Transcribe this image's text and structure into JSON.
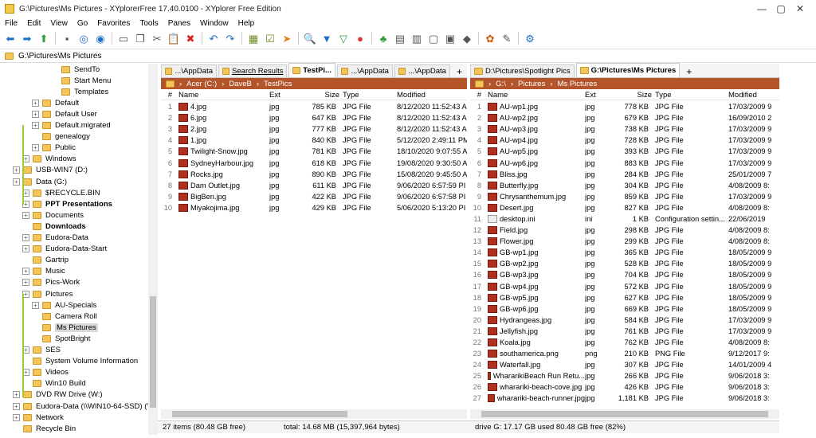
{
  "title": "G:\\Pictures\\Ms Pictures - XYplorerFree 17.40.0100 - XYplorer Free Edition",
  "window_controls": {
    "minimize": "—",
    "maximize": "▢",
    "close": "✕"
  },
  "menu": [
    "File",
    "Edit",
    "View",
    "Go",
    "Favorites",
    "Tools",
    "Panes",
    "Window",
    "Help"
  ],
  "toolbar_icons": [
    "back-icon",
    "forward-icon",
    "up-icon",
    "drives-icon",
    "target-icon",
    "target2-icon",
    "new-icon",
    "copy-icon",
    "cut-icon",
    "paste-icon",
    "delete-icon",
    "undo-icon",
    "redo-icon",
    "tree-icon",
    "checkbox-icon",
    "arrow-icon",
    "search-icon",
    "filter-icon",
    "filter2-icon",
    "palette-icon",
    "tree2-icon",
    "grid-icon",
    "panes-icon",
    "preview-icon",
    "preview2-icon",
    "tag-icon",
    "colors-icon",
    "brush-icon",
    "settings-icon"
  ],
  "address": "G:\\Pictures\\Ms Pictures",
  "tree": [
    {
      "label": "SendTo",
      "indent": 5,
      "exp": false
    },
    {
      "label": "Start Menu",
      "indent": 5,
      "exp": false
    },
    {
      "label": "Templates",
      "indent": 5,
      "exp": false
    },
    {
      "label": "Default",
      "indent": 3,
      "exp": true
    },
    {
      "label": "Default User",
      "indent": 3,
      "exp": true
    },
    {
      "label": "Default.migrated",
      "indent": 3,
      "exp": true
    },
    {
      "label": "genealogy",
      "indent": 3,
      "exp": false
    },
    {
      "label": "Public",
      "indent": 3,
      "exp": true
    },
    {
      "label": "Windows",
      "indent": 2,
      "exp": true
    },
    {
      "label": "USB-WIN7 (D:)",
      "indent": 1,
      "exp": true
    },
    {
      "label": "Data (G:)",
      "indent": 1,
      "exp": true
    },
    {
      "label": "$RECYCLE.BIN",
      "indent": 2,
      "exp": true
    },
    {
      "label": "PPT Presentations",
      "indent": 2,
      "exp": true,
      "bold": true
    },
    {
      "label": "Documents",
      "indent": 2,
      "exp": true
    },
    {
      "label": "Downloads",
      "indent": 2,
      "exp": false,
      "bold": true
    },
    {
      "label": "Eudora-Data",
      "indent": 2,
      "exp": true
    },
    {
      "label": "Eudora-Data-Start",
      "indent": 2,
      "exp": true
    },
    {
      "label": "Gartrip",
      "indent": 2,
      "exp": false
    },
    {
      "label": "Music",
      "indent": 2,
      "exp": true
    },
    {
      "label": "Pics-Work",
      "indent": 2,
      "exp": true
    },
    {
      "label": "Pictures",
      "indent": 2,
      "exp": true
    },
    {
      "label": "AU-Specials",
      "indent": 3,
      "exp": true
    },
    {
      "label": "Camera Roll",
      "indent": 3,
      "exp": false
    },
    {
      "label": "Ms Pictures",
      "indent": 3,
      "exp": false,
      "selected": true
    },
    {
      "label": "SpotBright",
      "indent": 3,
      "exp": false
    },
    {
      "label": "SES",
      "indent": 2,
      "exp": true
    },
    {
      "label": "System Volume Information",
      "indent": 2,
      "exp": false
    },
    {
      "label": "Videos",
      "indent": 2,
      "exp": true
    },
    {
      "label": "Win10 Build",
      "indent": 2,
      "exp": false
    },
    {
      "label": "DVD RW Drive (W:)",
      "indent": 1,
      "exp": true
    },
    {
      "label": "Eudora-Data (\\\\WIN10-64-SSD) (Y:)",
      "indent": 1,
      "exp": true
    },
    {
      "label": "Network",
      "indent": 1,
      "exp": true
    },
    {
      "label": "Recycle Bin",
      "indent": 1,
      "exp": false
    }
  ],
  "left_pane": {
    "tabs": [
      {
        "label": "...\\AppData"
      },
      {
        "label": "Search Results",
        "underline": true
      },
      {
        "label": "TestPi...",
        "active": true
      },
      {
        "label": "...\\AppData"
      },
      {
        "label": "...\\AppData"
      }
    ],
    "add_tab": "+",
    "crumbs": [
      "Acer (C:)",
      "DaveB",
      "TestPics"
    ],
    "columns": {
      "num": "#",
      "name": "Name",
      "ext": "Ext",
      "size": "Size",
      "type": "Type",
      "modified": "Modified"
    },
    "rows": [
      {
        "n": "1",
        "name": "4.jpg",
        "ext": "jpg",
        "size": "785 KB",
        "type": "JPG File",
        "mod": "8/12/2020 11:52:43 A"
      },
      {
        "n": "2",
        "name": "6.jpg",
        "ext": "jpg",
        "size": "647 KB",
        "type": "JPG File",
        "mod": "8/12/2020 11:52:43 A"
      },
      {
        "n": "3",
        "name": "2.jpg",
        "ext": "jpg",
        "size": "777 KB",
        "type": "JPG File",
        "mod": "8/12/2020 11:52:43 A"
      },
      {
        "n": "4",
        "name": "1.jpg",
        "ext": "jpg",
        "size": "840 KB",
        "type": "JPG File",
        "mod": "5/12/2020 2:49:11 PM"
      },
      {
        "n": "5",
        "name": "Twilight-Snow.jpg",
        "ext": "jpg",
        "size": "781 KB",
        "type": "JPG File",
        "mod": "18/10/2020 9:07:55 A"
      },
      {
        "n": "6",
        "name": "SydneyHarbour.jpg",
        "ext": "jpg",
        "size": "618 KB",
        "type": "JPG File",
        "mod": "19/08/2020 9:30:50 A"
      },
      {
        "n": "7",
        "name": "Rocks.jpg",
        "ext": "jpg",
        "size": "890 KB",
        "type": "JPG File",
        "mod": "15/08/2020 9:45:50 A"
      },
      {
        "n": "8",
        "name": "Dam Outlet.jpg",
        "ext": "jpg",
        "size": "611 KB",
        "type": "JPG File",
        "mod": "9/06/2020 6:57:59 PI"
      },
      {
        "n": "9",
        "name": "BigBen.jpg",
        "ext": "jpg",
        "size": "422 KB",
        "type": "JPG File",
        "mod": "9/06/2020 6:57:58 PI"
      },
      {
        "n": "10",
        "name": "Miyakojima.jpg",
        "ext": "jpg",
        "size": "429 KB",
        "type": "JPG File",
        "mod": "5/06/2020 5:13:20 PI"
      }
    ]
  },
  "right_pane": {
    "tabs": [
      {
        "label": "D:\\Pictures\\Spotlight Pics"
      },
      {
        "label": "G:\\Pictures\\Ms Pictures",
        "active": true
      }
    ],
    "add_tab": "+",
    "crumbs": [
      "G:\\",
      "Pictures",
      "Ms Pictures"
    ],
    "columns": {
      "num": "#",
      "name": "Name",
      "ext": "Ext",
      "size": "Size",
      "type": "Type",
      "modified": "Modified"
    },
    "rows": [
      {
        "n": "1",
        "name": "AU-wp1.jpg",
        "ext": "jpg",
        "size": "778 KB",
        "type": "JPG File",
        "mod": "17/03/2009 9"
      },
      {
        "n": "2",
        "name": "AU-wp2.jpg",
        "ext": "jpg",
        "size": "679 KB",
        "type": "JPG File",
        "mod": "16/09/2010 2"
      },
      {
        "n": "3",
        "name": "AU-wp3.jpg",
        "ext": "jpg",
        "size": "738 KB",
        "type": "JPG File",
        "mod": "17/03/2009 9"
      },
      {
        "n": "4",
        "name": "AU-wp4.jpg",
        "ext": "jpg",
        "size": "728 KB",
        "type": "JPG File",
        "mod": "17/03/2009 9"
      },
      {
        "n": "5",
        "name": "AU-wp5.jpg",
        "ext": "jpg",
        "size": "393 KB",
        "type": "JPG File",
        "mod": "17/03/2009 9"
      },
      {
        "n": "6",
        "name": "AU-wp6.jpg",
        "ext": "jpg",
        "size": "883 KB",
        "type": "JPG File",
        "mod": "17/03/2009 9"
      },
      {
        "n": "7",
        "name": "Bliss.jpg",
        "ext": "jpg",
        "size": "284 KB",
        "type": "JPG File",
        "mod": "25/01/2009 7"
      },
      {
        "n": "8",
        "name": "Butterfly.jpg",
        "ext": "jpg",
        "size": "304 KB",
        "type": "JPG File",
        "mod": "4/08/2009 8:"
      },
      {
        "n": "9",
        "name": "Chrysanthemum.jpg",
        "ext": "jpg",
        "size": "859 KB",
        "type": "JPG File",
        "mod": "17/03/2009 9"
      },
      {
        "n": "10",
        "name": "Desert.jpg",
        "ext": "jpg",
        "size": "827 KB",
        "type": "JPG File",
        "mod": "4/08/2009 8:"
      },
      {
        "n": "11",
        "name": "desktop.ini",
        "ext": "ini",
        "size": "1 KB",
        "type": "Configuration settin...",
        "mod": "22/06/2019",
        "ini": true
      },
      {
        "n": "12",
        "name": "Field.jpg",
        "ext": "jpg",
        "size": "298 KB",
        "type": "JPG File",
        "mod": "4/08/2009 8:"
      },
      {
        "n": "13",
        "name": "Flower.jpg",
        "ext": "jpg",
        "size": "299 KB",
        "type": "JPG File",
        "mod": "4/08/2009 8:"
      },
      {
        "n": "14",
        "name": "GB-wp1.jpg",
        "ext": "jpg",
        "size": "365 KB",
        "type": "JPG File",
        "mod": "18/05/2009 9"
      },
      {
        "n": "15",
        "name": "GB-wp2.jpg",
        "ext": "jpg",
        "size": "528 KB",
        "type": "JPG File",
        "mod": "18/05/2009 9"
      },
      {
        "n": "16",
        "name": "GB-wp3.jpg",
        "ext": "jpg",
        "size": "704 KB",
        "type": "JPG File",
        "mod": "18/05/2009 9"
      },
      {
        "n": "17",
        "name": "GB-wp4.jpg",
        "ext": "jpg",
        "size": "572 KB",
        "type": "JPG File",
        "mod": "18/05/2009 9"
      },
      {
        "n": "18",
        "name": "GB-wp5.jpg",
        "ext": "jpg",
        "size": "627 KB",
        "type": "JPG File",
        "mod": "18/05/2009 9"
      },
      {
        "n": "19",
        "name": "GB-wp6.jpg",
        "ext": "jpg",
        "size": "669 KB",
        "type": "JPG File",
        "mod": "18/05/2009 9"
      },
      {
        "n": "20",
        "name": "Hydrangeas.jpg",
        "ext": "jpg",
        "size": "584 KB",
        "type": "JPG File",
        "mod": "17/03/2009 9"
      },
      {
        "n": "21",
        "name": "Jellyfish.jpg",
        "ext": "jpg",
        "size": "761 KB",
        "type": "JPG File",
        "mod": "17/03/2009 9"
      },
      {
        "n": "22",
        "name": "Koala.jpg",
        "ext": "jpg",
        "size": "762 KB",
        "type": "JPG File",
        "mod": "4/08/2009 8:"
      },
      {
        "n": "23",
        "name": "southamerica.png",
        "ext": "png",
        "size": "210 KB",
        "type": "PNG File",
        "mod": "9/12/2017 9:"
      },
      {
        "n": "24",
        "name": "Waterfall.jpg",
        "ext": "jpg",
        "size": "307 KB",
        "type": "JPG File",
        "mod": "14/01/2009 4"
      },
      {
        "n": "25",
        "name": "WhararikiBeach Run Retu...",
        "ext": "jpg",
        "size": "266 KB",
        "type": "JPG File",
        "mod": "9/06/2018 3:"
      },
      {
        "n": "26",
        "name": "wharariki-beach-cove.jpg",
        "ext": "jpg",
        "size": "426 KB",
        "type": "JPG File",
        "mod": "9/06/2018 3:"
      },
      {
        "n": "27",
        "name": "wharariki-beach-runner.jpg",
        "ext": "jpg",
        "size": "1,181 KB",
        "type": "JPG File",
        "mod": "9/06/2018 3:"
      }
    ]
  },
  "status": {
    "items": "27 items (80.48 GB free)",
    "total": "total: 14.68 MB (15,397,964 bytes)",
    "drive": "drive G:  17.17 GB used   80.48 GB free (82%)"
  },
  "colors": {
    "crumb_bg": "#b3542a",
    "accent": "#1e6fc8"
  }
}
